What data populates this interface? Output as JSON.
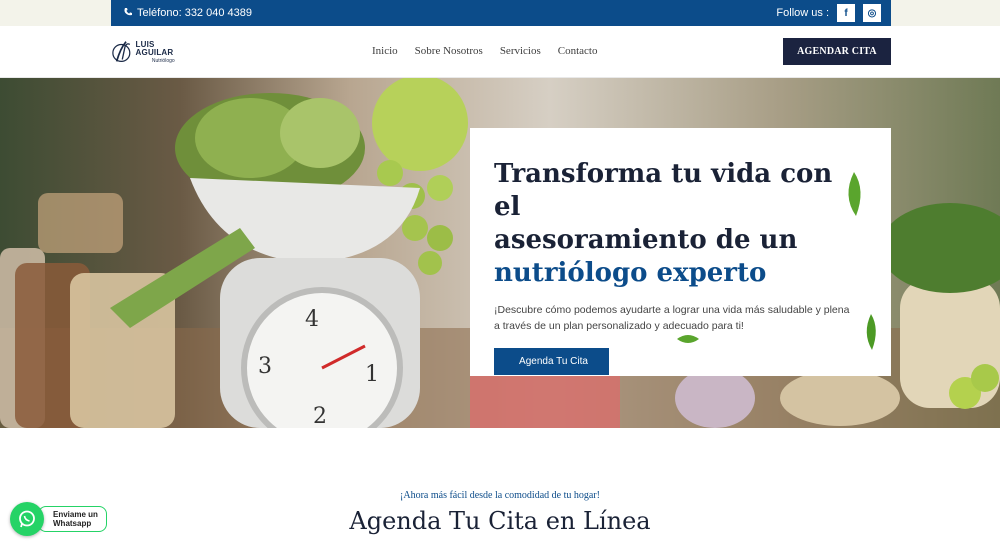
{
  "topbar": {
    "phone": "Teléfono: 332 040 4389",
    "follow_label": "Follow us :",
    "social": [
      {
        "icon": "facebook-icon",
        "glyph": "f"
      },
      {
        "icon": "instagram-icon",
        "glyph": "◎"
      }
    ]
  },
  "header": {
    "logo_name": "LUIS AGUILAR",
    "logo_sub": "Nutriólogo",
    "nav": [
      "Inicio",
      "Sobre Nosotros",
      "Servicios",
      "Contacto"
    ],
    "cta": "AGENDAR CITA"
  },
  "hero": {
    "title_line1": "Transforma tu vida con el",
    "title_line2": "asesoramiento de un",
    "title_accent": "nutriólogo experto",
    "description": "¡Descubre cómo podemos ayudarte a lograr una vida más saludable y plena a través de un plan personalizado y adecuado para ti!",
    "button": "Agenda Tu Cita"
  },
  "section": {
    "kicker": "¡Ahora más fácil desde la comodidad de tu hogar!",
    "title": "Agenda Tu Cita en Línea"
  },
  "whatsapp": {
    "line1": "Enviame un",
    "line2": "Whatsapp"
  },
  "colors": {
    "brand_blue": "#0c4c8a",
    "navy": "#1b2340",
    "whatsapp_green": "#25d366"
  }
}
